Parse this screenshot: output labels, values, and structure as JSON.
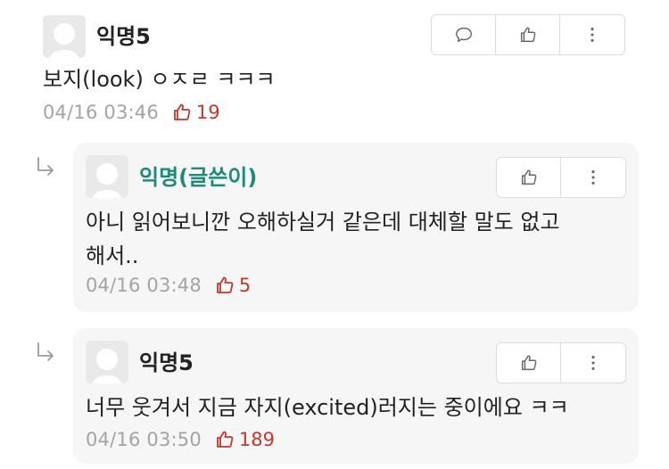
{
  "comments": [
    {
      "author": "익명5",
      "text": "보지(look) ㅇㅈㄹ ㅋㅋㅋ",
      "time": "04/16 03:46",
      "likes": "19"
    }
  ],
  "replies": [
    {
      "author": "익명(글쓴이)",
      "text": "아니 읽어보니깐 오해하실거 같은데 대체할 말도 없고\n해서..",
      "time": "04/16 03:48",
      "likes": "5"
    },
    {
      "author": "익명5",
      "text": "너무 웃겨서 지금 자지(excited)러지는 중이에요 ㅋㅋ",
      "time": "04/16 03:50",
      "likes": "189"
    }
  ],
  "icons": {
    "comment": "speech-bubble-icon",
    "like": "thumbs-up-icon",
    "more": "more-vertical-icon",
    "reply": "reply-arrow-icon",
    "avatar": "default-avatar"
  },
  "colors": {
    "op_author": "#1f8a77",
    "like_count": "#c0392b",
    "timestamp": "#a3a3a3",
    "reply_bg": "#f6f6f6"
  }
}
